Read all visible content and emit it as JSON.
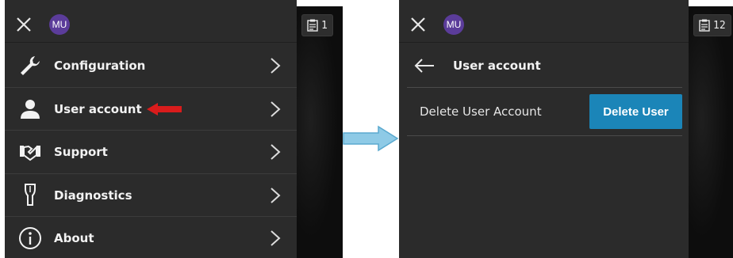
{
  "left_screen": {
    "avatar_initials": "MU",
    "menu": [
      {
        "label": "Configuration",
        "icon": "wrench-icon"
      },
      {
        "label": "User account",
        "icon": "user-icon"
      },
      {
        "label": "Support",
        "icon": "handshake-icon"
      },
      {
        "label": "Diagnostics",
        "icon": "probe-icon"
      },
      {
        "label": "About",
        "icon": "info-icon"
      }
    ],
    "tab_count": "1"
  },
  "right_screen": {
    "avatar_initials": "MU",
    "title": "User account",
    "row_label": "Delete User Account",
    "delete_button": "Delete User",
    "tab_count": "12"
  },
  "colors": {
    "panel_bg": "#2b2b2b",
    "avatar": "#5b3c9a",
    "button": "#1b85b8",
    "highlight_arrow": "#d91c1c",
    "flow_arrow": "#8ecae6"
  }
}
